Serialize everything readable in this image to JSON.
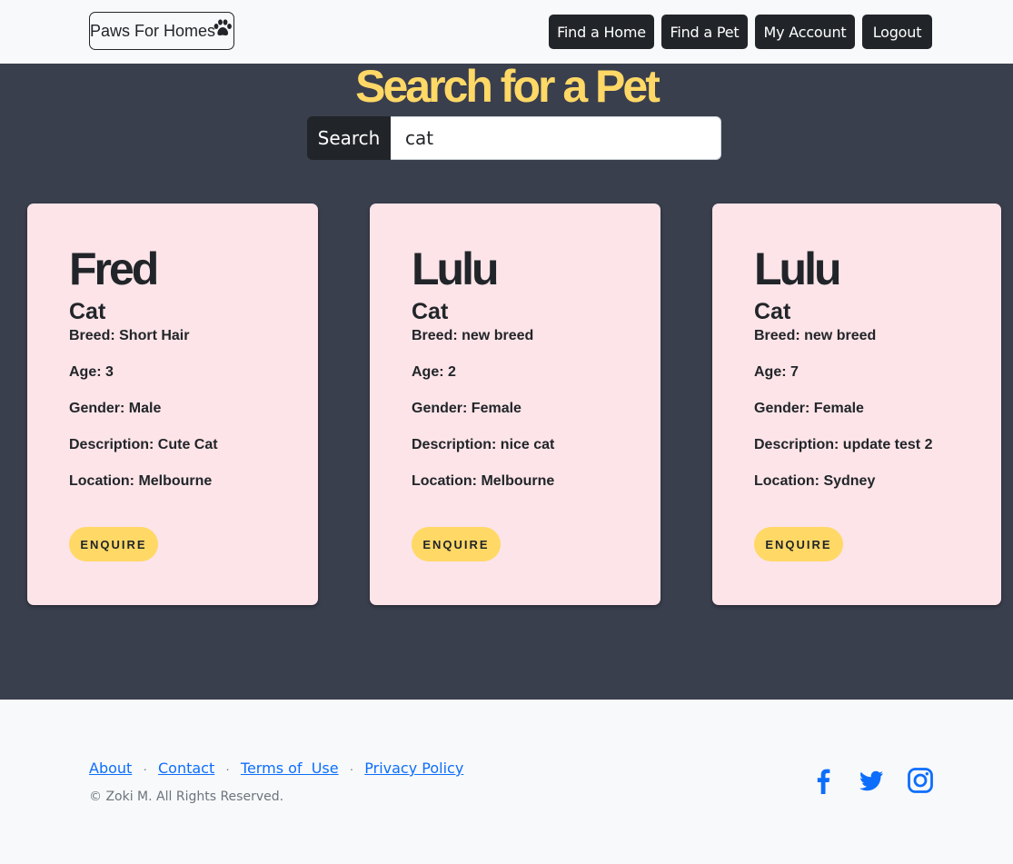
{
  "navbar": {
    "brand": "Paws For Homes",
    "links": [
      "Find a Home",
      "Find a Pet",
      "My Account",
      "Logout"
    ]
  },
  "main": {
    "title": "Search for a Pet",
    "search": {
      "label": "Search",
      "value": "cat"
    }
  },
  "pets": [
    {
      "name": "Fred",
      "type": "Cat",
      "breed": "Breed: Short Hair",
      "age": "Age: 3",
      "gender": "Gender: Male",
      "description": "Description: Cute Cat",
      "location": "Location: Melbourne",
      "button": "ENQUIRE"
    },
    {
      "name": "Lulu",
      "type": "Cat",
      "breed": "Breed: new breed",
      "age": "Age: 2",
      "gender": "Gender: Female",
      "description": "Description: nice cat",
      "location": "Location: Melbourne",
      "button": "ENQUIRE"
    },
    {
      "name": "Lulu",
      "type": "Cat",
      "breed": "Breed: new breed",
      "age": "Age: 7",
      "gender": "Gender: Female",
      "description": "Description: update test 2",
      "location": "Location: Sydney",
      "button": "ENQUIRE"
    }
  ],
  "footer": {
    "links": [
      "About",
      "Contact",
      "Terms of  Use",
      "Privacy Policy"
    ],
    "copyright": "© Zoki M. All Rights Reserved.",
    "social_icons": [
      "facebook-icon",
      "twitter-icon",
      "instagram-icon"
    ]
  },
  "colors": {
    "accent": "#ffd866",
    "main_bg": "#3a3f4e",
    "card_bg": "#fce4e8",
    "button_dark": "#212529",
    "link": "#0d6efd"
  }
}
